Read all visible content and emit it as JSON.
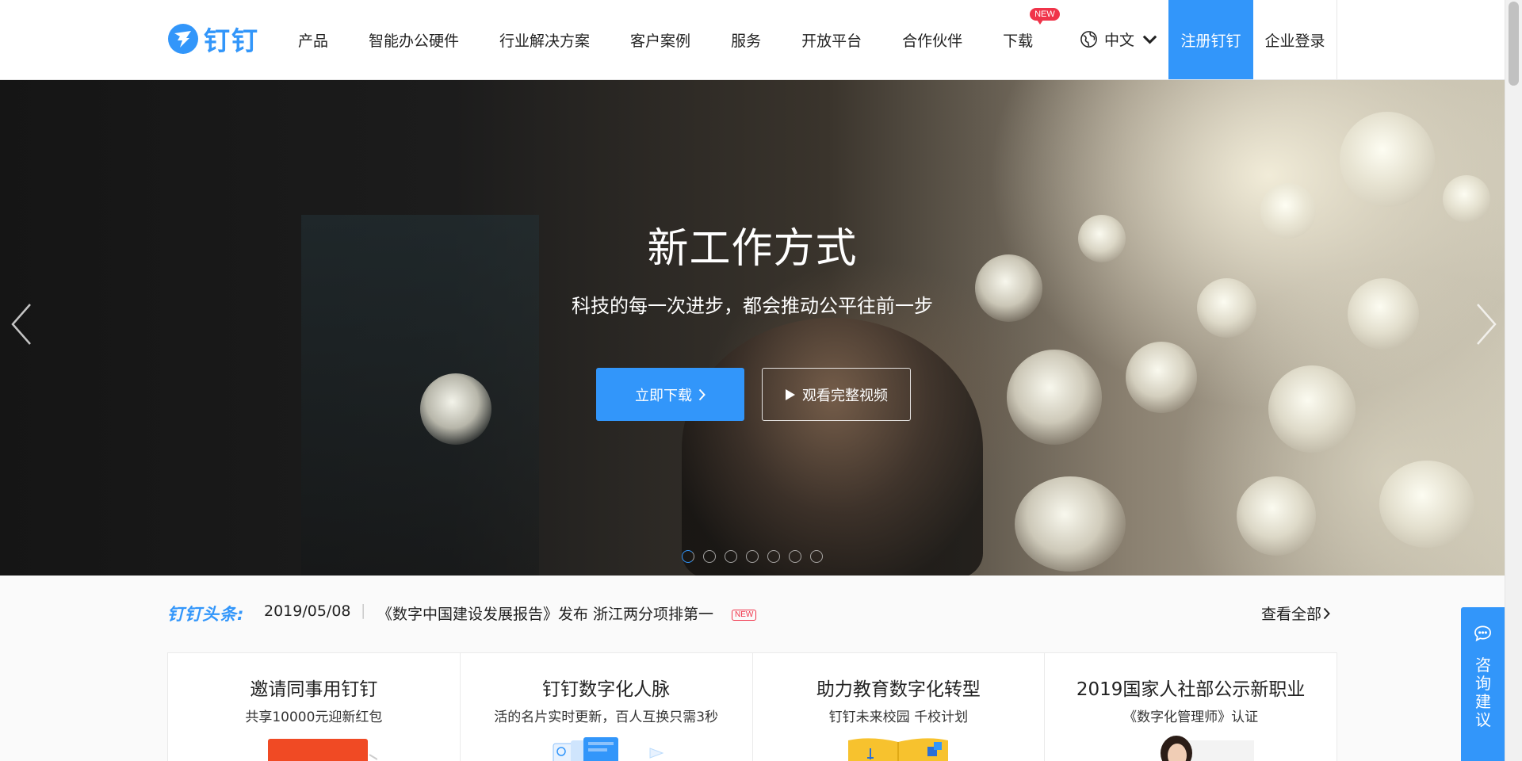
{
  "header": {
    "logo_text": "钉钉",
    "nav": [
      {
        "label": "产品"
      },
      {
        "label": "智能办公硬件"
      },
      {
        "label": "行业解决方案"
      },
      {
        "label": "客户案例"
      },
      {
        "label": "服务"
      },
      {
        "label": "开放平台"
      },
      {
        "label": "合作伙伴"
      },
      {
        "label": "下载",
        "badge": "NEW"
      }
    ],
    "language": "中文",
    "register_label": "注册钉钉",
    "login_label": "企业登录",
    "accent_color": "#3296fa"
  },
  "hero": {
    "title": "新工作方式",
    "subtitle": "科技的每一次进步，都会推动公平往前一步",
    "download_button": "立即下载",
    "video_button": "观看完整视频",
    "slide_count": 7,
    "active_slide": 1
  },
  "news": {
    "label": "钉钉头条:",
    "date": "2019/05/08",
    "separator": "|",
    "headline": "《数字中国建设发展报告》发布 浙江两分项排第一",
    "badge": "NEW",
    "view_all": "查看全部"
  },
  "cards": [
    {
      "title": "邀请同事用钉钉",
      "subtitle": "共享10000元迎新红包"
    },
    {
      "title": "钉钉数字化人脉",
      "subtitle": "活的名片实时更新，百人互换只需3秒"
    },
    {
      "title": "助力教育数字化转型",
      "subtitle": "钉钉未来校园 千校计划"
    },
    {
      "title": "2019国家人社部公示新职业",
      "subtitle": "《数字化管理师》认证"
    }
  ],
  "consult": {
    "label": "咨询建议"
  }
}
